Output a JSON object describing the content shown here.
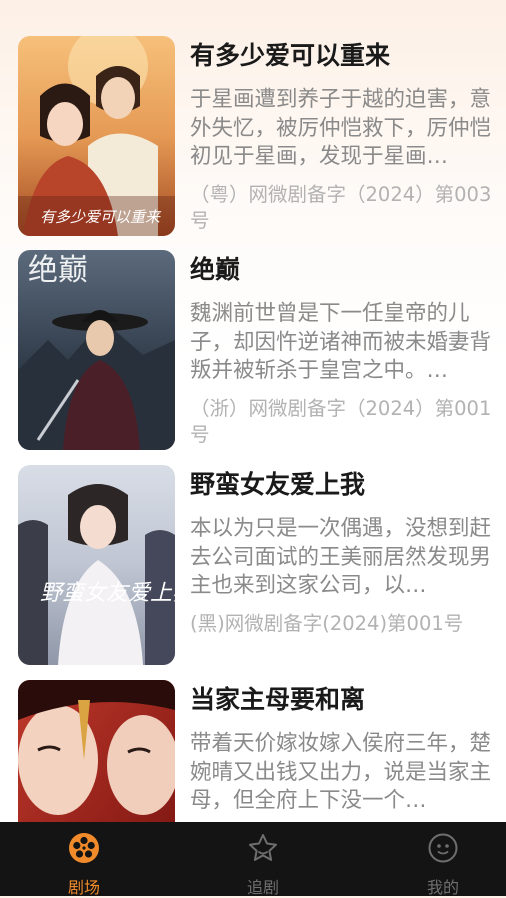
{
  "dramas": [
    {
      "title": "有多少爱可以重来",
      "description": "于星画遭到养子于越的迫害，意外失忆，被厉仲恺救下，厉仲恺初见于星画，发现于星画…",
      "license": "（粤）网微剧备字（2024）第003号",
      "poster_text": "有多少爱可以重来"
    },
    {
      "title": "绝巅",
      "description": "魏渊前世曾是下一任皇帝的儿子，却因忤逆诸神而被未婚妻背叛并被斩杀于皇宫之中。…",
      "license": "（浙）网微剧备字（2024）第001号",
      "poster_text": "绝巅"
    },
    {
      "title": "野蛮女友爱上我",
      "description": "本以为只是一次偶遇，没想到赶去公司面试的王美丽居然发现男主也来到这家公司，以…",
      "license": "(黑)网微剧备字(2024)第001号",
      "poster_text": "野蛮女友爱上我"
    },
    {
      "title": "当家主母要和离",
      "description": "带着天价嫁妆嫁入侯府三年，楚婉晴又出钱又出力，说是当家主母，但全府上下没一个…",
      "license": "",
      "poster_text": ""
    }
  ],
  "tabs": [
    {
      "label": "剧场",
      "icon": "film-reel-icon",
      "active": true
    },
    {
      "label": "追剧",
      "icon": "star-icon",
      "active": false
    },
    {
      "label": "我的",
      "icon": "profile-face-icon",
      "active": false
    }
  ],
  "colors": {
    "accent": "#f08a2a",
    "tabbar_bg": "#141414",
    "title": "#1a1a1a",
    "desc": "#8a8a8a"
  }
}
